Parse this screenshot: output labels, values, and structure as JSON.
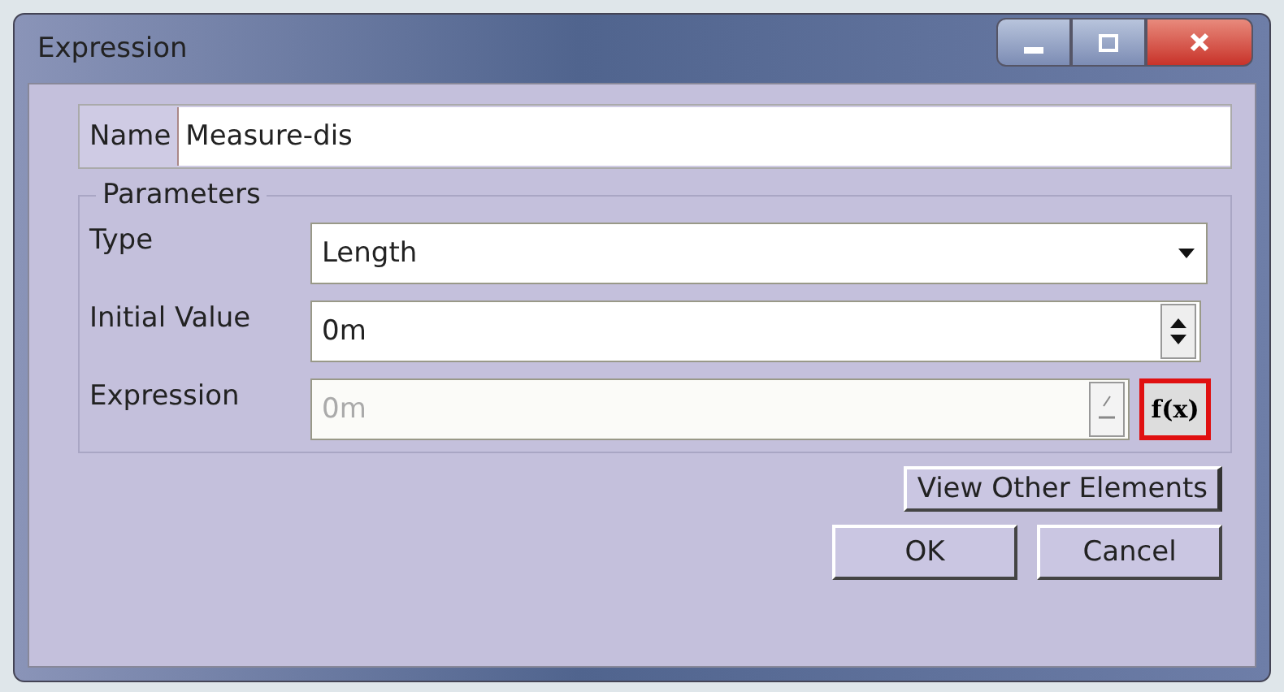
{
  "window": {
    "title": "Expression"
  },
  "name_field": {
    "label": "Name",
    "value": "Measure-dis"
  },
  "parameters": {
    "title": "Parameters",
    "rows": [
      {
        "kind": "dropdown",
        "label": "Type",
        "value": "Length",
        "disabled": false
      },
      {
        "kind": "spinner",
        "label": "Initial Value",
        "value": "0m",
        "disabled": false
      },
      {
        "kind": "formula",
        "label": "Expression",
        "value": "0m",
        "disabled": true,
        "formula_button": "f(x)",
        "highlighted": true
      }
    ]
  },
  "buttons": [
    {
      "label": "View Other Elements",
      "kind": "wide"
    },
    {
      "label": "OK",
      "kind": "normal"
    },
    {
      "label": "Cancel",
      "kind": "normal"
    }
  ]
}
